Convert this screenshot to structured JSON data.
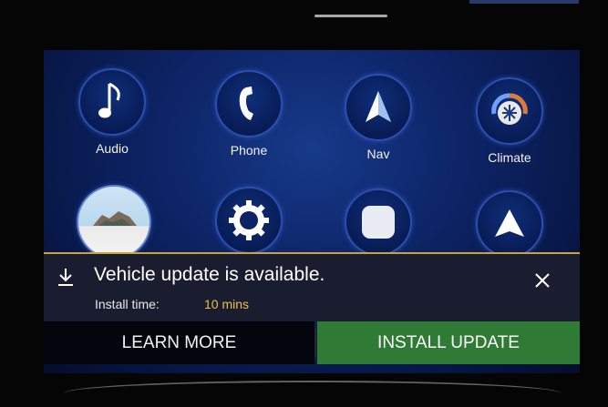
{
  "apps": [
    {
      "label": "Audio",
      "icon": "music-note-icon"
    },
    {
      "label": "Phone",
      "icon": "phone-icon"
    },
    {
      "label": "Nav",
      "icon": "nav-arrow-icon"
    },
    {
      "label": "Climate",
      "icon": "climate-icon"
    },
    {
      "label": "",
      "icon": "photo-icon"
    },
    {
      "label": "",
      "icon": "settings-gear-icon"
    },
    {
      "label": "",
      "icon": "app-square-icon"
    },
    {
      "label": "",
      "icon": "nav-arrow-icon"
    }
  ],
  "notification": {
    "title": "Vehicle update is available.",
    "install_label": "Install time:",
    "install_value": "10 mins"
  },
  "buttons": {
    "learn_more": "LEARN MORE",
    "install_update": "INSTALL UPDATE"
  },
  "colors": {
    "accent_gold": "#c9a437",
    "install_green": "#2f7a34",
    "screen_blue": "#0d2466"
  }
}
